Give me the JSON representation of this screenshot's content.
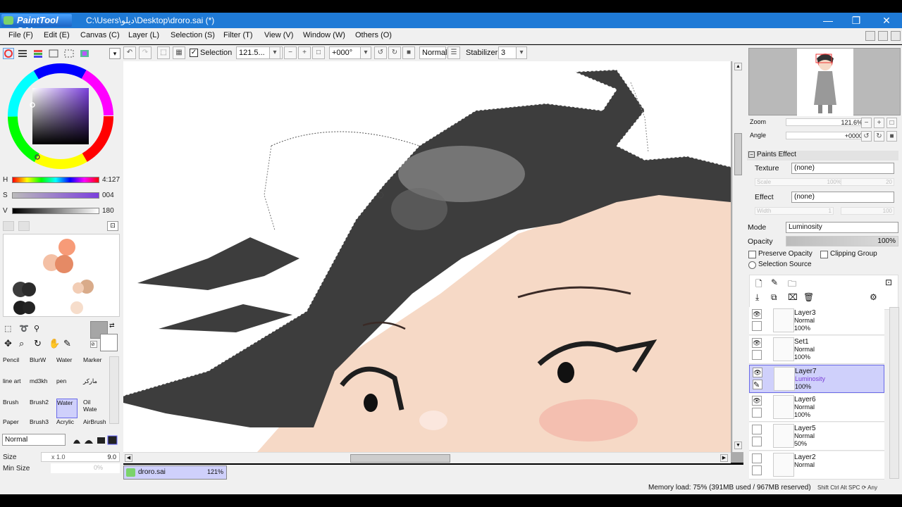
{
  "titlebar": {
    "app_name": "PaintTool SAI",
    "path": "C:\\Users\\دیلو\\Desktop\\droro.sai (*)",
    "min": "—",
    "max": "❐",
    "close": "✕"
  },
  "menu": {
    "items": [
      "File (F)",
      "Edit (E)",
      "Canvas (C)",
      "Layer (L)",
      "Selection (S)",
      "Filter (T)",
      "View (V)",
      "Window (W)",
      "Others (O)"
    ]
  },
  "toolbar": {
    "selection_label": "Selection",
    "zoom_value": "121.5...",
    "angle_value": "+000°",
    "mode_value": "Normal",
    "stabilizer_label": "Stabilizer",
    "stabilizer_value": "3"
  },
  "color": {
    "h_label": "H",
    "h_value": "4:127",
    "s_label": "S",
    "s_value": "004",
    "v_label": "V",
    "v_value": "180",
    "current_fg": "#a6a6a6",
    "swatches": [
      "#f79b78",
      "#f4c0a5",
      "#e58a65",
      "#3c3c3c",
      "#d9ab8a",
      "#2b2b2b",
      "#f6ddcb",
      "#1e1e1e"
    ]
  },
  "brushes": {
    "rows": [
      [
        "Pencil",
        "BlurW",
        "Water",
        "Marker"
      ],
      [
        "line art",
        "md3kh",
        "pen",
        "مارکر"
      ],
      [
        "Brush",
        "Brush2",
        "Water",
        "Oil Wate"
      ],
      [
        "Paper",
        "Brush3",
        "Acrylic",
        "AirBrush"
      ]
    ],
    "blend_mode": "Normal",
    "size_label": "Size",
    "size_mult": "x 1.0",
    "size_value": "9.0",
    "min_size_label": "Min Size",
    "min_size_value": "0%"
  },
  "navigator": {
    "zoom_label": "Zoom",
    "zoom_value": "121.6%",
    "angle_label": "Angle",
    "angle_value": "+0000"
  },
  "paints_effect": {
    "header": "Paints Effect",
    "texture_label": "Texture",
    "texture_value": "(none)",
    "scale_label": "Scale",
    "scale_value": "100%",
    "texture_num": "20",
    "effect_label": "Effect",
    "effect_value": "(none)",
    "width_label": "Width",
    "width_value": "1",
    "effect_num": "100"
  },
  "layer_props": {
    "mode_label": "Mode",
    "mode_value": "Luminosity",
    "opacity_label": "Opacity",
    "opacity_value": "100%",
    "preserve_opacity": "Preserve Opacity",
    "clipping_group": "Clipping Group",
    "selection_source": "Selection Source"
  },
  "layers": [
    {
      "name": "Layer3",
      "mode": "Normal",
      "opacity": "100%",
      "visible": true,
      "selected": false
    },
    {
      "name": "Set1",
      "mode": "Normal",
      "opacity": "100%",
      "visible": true,
      "selected": false
    },
    {
      "name": "Layer7",
      "mode": "Luminosity",
      "opacity": "100%",
      "visible": true,
      "selected": true
    },
    {
      "name": "Layer6",
      "mode": "Normal",
      "opacity": "100%",
      "visible": true,
      "selected": false
    },
    {
      "name": "Layer5",
      "mode": "Normal",
      "opacity": "50%",
      "visible": false,
      "selected": false
    },
    {
      "name": "Layer2",
      "mode": "Normal",
      "opacity": "",
      "visible": false,
      "selected": false
    }
  ],
  "docbar": {
    "doc_name": "droro.sai",
    "doc_zoom": "121%"
  },
  "status": {
    "memory": "Memory load: 75% (391MB used / 967MB reserved)",
    "keys": "Shift Ctrl Alt SPC ⟳ Any"
  }
}
